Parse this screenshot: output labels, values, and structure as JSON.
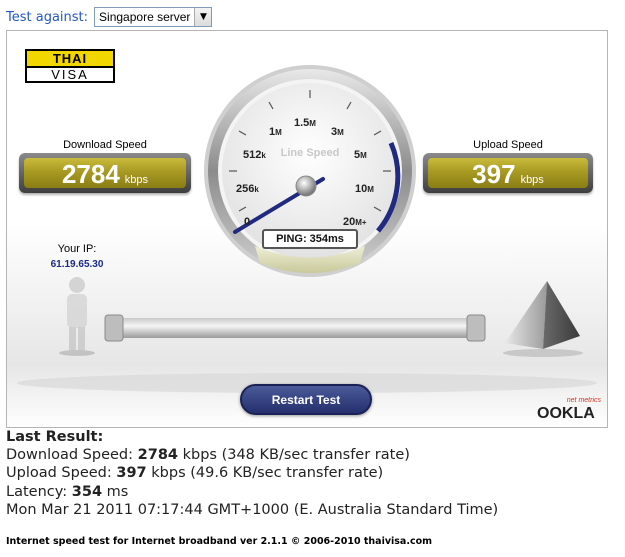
{
  "top": {
    "label": "Test against:",
    "server_selected": "Singapore server",
    "dropdown_arrow": "▼"
  },
  "logo": {
    "line1": "THAI",
    "line2": "VISA"
  },
  "download": {
    "title": "Download Speed",
    "value": "2784",
    "unit": "kbps"
  },
  "upload": {
    "title": "Upload Speed",
    "value": "397",
    "unit": "kbps"
  },
  "gauge": {
    "label": "Line Speed",
    "ticks": [
      {
        "main": "0",
        "sub": ""
      },
      {
        "main": "256",
        "sub": "k"
      },
      {
        "main": "512",
        "sub": "k"
      },
      {
        "main": "1",
        "sub": "M"
      },
      {
        "main": "1.5",
        "sub": "M"
      },
      {
        "main": "3",
        "sub": "M"
      },
      {
        "main": "5",
        "sub": "M"
      },
      {
        "main": "10",
        "sub": "M"
      },
      {
        "main": "20",
        "sub": "M+"
      }
    ],
    "ping": "PING: 354ms"
  },
  "yourip": {
    "title": "Your IP:",
    "value": "61.19.65.30"
  },
  "restart_label": "Restart Test",
  "ookla": {
    "netmetrics": "net metrics",
    "brand": "OOKLA"
  },
  "results": {
    "heading": "Last Result:",
    "dl_prefix": "Download Speed: ",
    "dl_value": "2784",
    "dl_suffix": " kbps (348 KB/sec transfer rate)",
    "ul_prefix": "Upload Speed: ",
    "ul_value": "397",
    "ul_suffix": " kbps (49.6 KB/sec transfer rate)",
    "lat_prefix": "Latency: ",
    "lat_value": "354",
    "lat_suffix": " ms",
    "timestamp": "Mon Mar 21 2011 07:17:44 GMT+1000 (E. Australia Standard Time)"
  },
  "footer": "Internet speed test for Internet broadband ver 2.1.1 © 2006-2010 thaivisa.com",
  "colors": {
    "label_blue": "#2458c0",
    "meter_gold": "#a89a22",
    "button_navy": "#2a3575",
    "needle": "#1f2a80",
    "ip_blue": "#1a2a8a"
  }
}
